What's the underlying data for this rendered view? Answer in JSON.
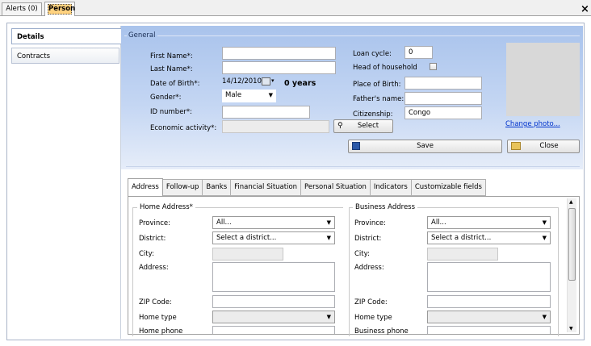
{
  "tabs": {
    "alerts": "Alerts (0)",
    "person": "Person",
    "close": "×"
  },
  "side": {
    "details": "Details",
    "contracts": "Contracts"
  },
  "general": {
    "legend": "General",
    "first_name_label": "First Name*:",
    "first_name": "",
    "last_name_label": "Last Name*:",
    "last_name": "",
    "dob_label": "Date of Birth*:",
    "dob": "14/12/2010",
    "age": "0 years",
    "gender_label": "Gender*:",
    "gender": "Male",
    "id_label": "ID number*:",
    "id_number": "",
    "econ_label": "Economic activity*:",
    "econ": "",
    "select_button": "Select",
    "loan_cycle_label": "Loan cycle:",
    "loan_cycle": "0",
    "hoh_label": "Head of household",
    "pob_label": "Place of Birth:",
    "pob": "",
    "father_label": "Father's name:",
    "father": "",
    "citizenship_label": "Citizenship:",
    "citizenship": "Congo",
    "change_photo": "Change photo...",
    "save": "Save",
    "close": "Close"
  },
  "subtabs": [
    "Address",
    "Follow-up",
    "Banks",
    "Financial Situation",
    "Personal Situation",
    "Indicators",
    "Customizable fields"
  ],
  "home": {
    "legend": "Home Address*",
    "province_label": "Province:",
    "province": "All...",
    "district_label": "District:",
    "district": "Select a district...",
    "city_label": "City:",
    "address_label": "Address:",
    "zip_label": "ZIP Code:",
    "type_label": "Home type",
    "phone_label": "Home phone"
  },
  "business": {
    "legend": "Business Address",
    "province_label": "Province:",
    "province": "All...",
    "district_label": "District:",
    "district": "Select a district...",
    "city_label": "City:",
    "address_label": "Address:",
    "zip_label": "ZIP Code:",
    "type_label": "Home type",
    "phone_label": "Business phone"
  },
  "colors": {
    "panel_top": "#a9c3ec",
    "panel_bottom": "#e6edf9",
    "link": "#0033cc"
  }
}
